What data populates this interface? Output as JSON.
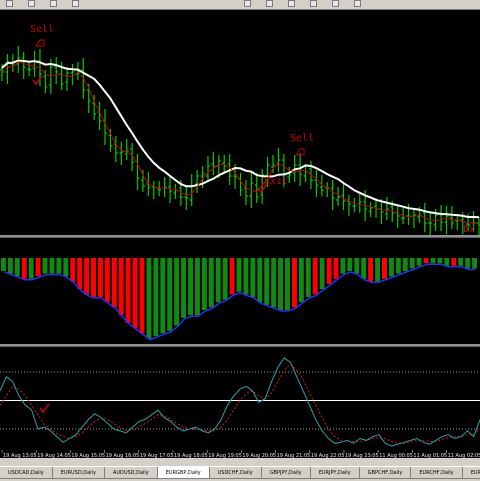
{
  "colors": {
    "background": "#000000",
    "bullish_bar": "#00cc00",
    "bearish_bar": "#ff0000",
    "fast_ma": "#cc0000",
    "slow_ma": "#ffffff",
    "macd_line": "#2030ff",
    "stoch_main": "#2f9fa8",
    "stoch_signal": "#cc2020",
    "signal_text": "#cc0000",
    "separator": "#c0c0c0"
  },
  "toolbar": {
    "icons": [
      "new-chart-icon",
      "zoom-in-icon",
      "zoom-out-icon",
      "arrow-icon",
      "crosshair-icon",
      "line-icon",
      "text-icon",
      "period-icon",
      "indicator-icon",
      "navigator-icon"
    ]
  },
  "signals": {
    "sell_1": "Sell",
    "sell_2": "Sell",
    "exit_1": "Exit",
    "exit_2": "Ex"
  },
  "time_axis": [
    "19 Aug 13:05",
    "19 Aug 14:05",
    "19 Aug 15:05",
    "19 Aug 16:05",
    "19 Aug 17:05",
    "19 Aug 18:05",
    "19 Aug 19:05",
    "19 Aug 20:05",
    "19 Aug 21:05",
    "19 Aug 22:05",
    "19 Aug 23:05",
    "11 Aug 00:05",
    "11 Aug 01:05",
    "11 Aug 02:05"
  ],
  "tabs": [
    "USDCAD,Daily",
    "EURUSD,Daily",
    "AUDUSD,Daily",
    "EURGBP,Daily",
    "USDCHF,Daily",
    "GBPJPY,Daily",
    "EURJPY,Daily",
    "GBPCHF,Daily",
    "EURCHF,Daily",
    "EURAUD,Daily"
  ],
  "active_tab": 3,
  "chart_data": [
    {
      "type": "ohlc",
      "panel": "price",
      "closes": [
        62,
        52,
        56,
        48,
        57,
        60,
        51,
        64,
        77,
        57,
        62,
        74,
        63,
        62,
        62,
        80,
        91,
        104,
        111,
        123,
        136,
        143,
        142,
        141,
        152,
        168,
        176,
        177,
        177,
        180,
        177,
        181,
        180,
        187,
        188,
        176,
        166,
        164,
        156,
        156,
        151,
        156,
        166,
        167,
        180,
        186,
        173,
        187,
        165,
        155,
        155,
        150,
        165,
        165,
        155,
        164,
        161,
        170,
        175,
        180,
        178,
        188,
        187,
        191,
        194,
        196,
        192,
        199,
        198,
        199,
        202,
        199,
        203,
        206,
        208,
        206,
        205,
        205,
        213,
        213,
        205,
        212,
        206,
        213,
        210,
        212,
        215,
        213,
        215
      ],
      "fast_ma_closes": [
        62,
        52,
        56,
        48,
        57,
        60,
        51,
        64,
        77,
        57,
        62,
        74,
        63,
        62,
        62,
        80,
        91,
        104,
        111,
        123,
        136,
        143,
        142,
        141,
        152,
        168,
        176,
        177,
        177,
        180,
        177,
        181,
        180,
        187,
        188,
        176,
        166,
        164,
        156,
        156,
        151,
        156,
        166,
        167,
        180,
        186,
        173,
        187,
        165,
        155,
        155,
        150,
        165,
        165,
        155,
        164,
        161,
        170,
        175,
        180,
        178,
        188,
        187,
        191,
        194,
        196,
        192,
        199,
        198,
        199,
        202,
        199,
        203,
        206,
        208,
        206,
        205,
        205,
        213,
        213,
        205,
        212,
        206,
        213,
        210,
        212,
        215,
        213,
        215
      ]
    },
    {
      "type": "bar",
      "panel": "macd",
      "values": [
        5,
        6,
        7,
        8,
        8,
        7,
        6,
        6,
        6,
        7,
        9,
        12,
        14,
        15,
        15,
        17,
        19,
        22,
        25,
        27,
        29,
        31,
        30,
        29,
        28,
        26,
        23,
        22,
        22,
        20,
        19,
        17,
        16,
        14,
        13,
        14,
        15,
        17,
        18,
        19,
        20,
        20,
        19,
        17,
        15,
        14,
        12,
        10,
        8,
        6,
        5,
        6,
        8,
        9,
        9,
        8,
        7,
        6,
        5,
        4,
        3,
        2,
        2,
        2,
        3,
        3,
        3,
        4,
        4
      ],
      "colors": [
        "g",
        "g",
        "g",
        "r",
        "g",
        "r",
        "g",
        "g",
        "g",
        "g",
        "r",
        "r",
        "r",
        "r",
        "r",
        "r",
        "r",
        "r",
        "r",
        "r",
        "r",
        "g",
        "g",
        "g",
        "g",
        "g",
        "g",
        "g",
        "g",
        "g",
        "g",
        "g",
        "g",
        "r",
        "g",
        "g",
        "g",
        "g",
        "g",
        "g",
        "g",
        "g",
        "r",
        "g",
        "g",
        "r",
        "g",
        "r",
        "r",
        "g",
        "g",
        "g",
        "g",
        "r",
        "g",
        "r",
        "g",
        "g",
        "g",
        "g",
        "g",
        "r",
        "g",
        "g",
        "g",
        "r",
        "g",
        "g",
        "g"
      ]
    },
    {
      "type": "line",
      "panel": "stochastic",
      "series": [
        {
          "values": [
            60,
            75,
            70,
            55,
            45,
            40,
            20,
            22,
            18,
            12,
            6,
            10,
            14,
            22,
            30,
            36,
            32,
            26,
            20,
            18,
            16,
            22,
            28,
            30,
            35,
            40,
            32,
            28,
            22,
            18,
            20,
            22,
            18,
            16,
            20,
            30,
            45,
            55,
            62,
            65,
            60,
            48,
            52,
            70,
            85,
            95,
            90,
            75,
            60,
            45,
            30,
            18,
            10,
            5,
            6,
            8,
            5,
            10,
            8,
            12,
            14,
            5,
            2,
            4,
            6,
            8,
            10,
            6,
            4,
            8,
            12,
            14,
            10,
            12,
            18,
            12,
            30
          ]
        },
        {
          "values": [
            45,
            55,
            65,
            62,
            55,
            45,
            35,
            25,
            20,
            15,
            12,
            10,
            12,
            16,
            22,
            28,
            32,
            30,
            26,
            22,
            18,
            19,
            22,
            26,
            30,
            35,
            34,
            30,
            26,
            22,
            20,
            20,
            19,
            18,
            18,
            22,
            30,
            40,
            50,
            57,
            60,
            55,
            52,
            58,
            70,
            82,
            88,
            82,
            72,
            58,
            45,
            32,
            20,
            12,
            8,
            7,
            7,
            7,
            8,
            10,
            11,
            10,
            7,
            5,
            5,
            6,
            8,
            8,
            7,
            7,
            9,
            11,
            12,
            12,
            14,
            14,
            20
          ]
        }
      ],
      "levels": [
        80,
        50,
        20
      ]
    }
  ]
}
